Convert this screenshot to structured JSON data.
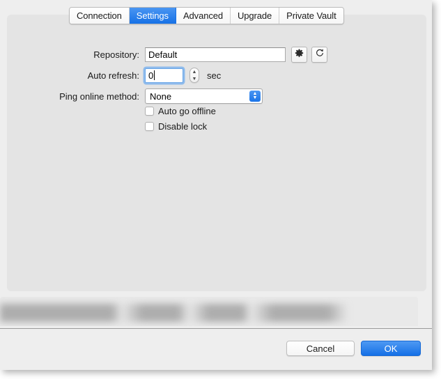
{
  "window": {
    "tabs": [
      {
        "label": "Connection",
        "selected": false
      },
      {
        "label": "Settings",
        "selected": true
      },
      {
        "label": "Advanced",
        "selected": false
      },
      {
        "label": "Upgrade",
        "selected": false
      },
      {
        "label": "Private Vault",
        "selected": false
      }
    ]
  },
  "settings": {
    "repository": {
      "label": "Repository:",
      "value": "Default",
      "placeholder": "",
      "gear_icon": "gear-icon",
      "refresh_icon": "refresh-icon"
    },
    "auto_refresh": {
      "label": "Auto refresh:",
      "value": "0",
      "unit": "sec",
      "focused": true,
      "stepper_up_icon": "chevron-up-icon",
      "stepper_down_icon": "chevron-down-icon"
    },
    "ping_online_method": {
      "label": "Ping online method:",
      "value": "None",
      "options": [
        "None"
      ],
      "arrow_icon": "chevron-up-down-icon"
    },
    "checkboxes": [
      {
        "label": "Auto go offline",
        "checked": false
      },
      {
        "label": "Disable lock",
        "checked": false
      }
    ]
  },
  "footer": {
    "cancel_label": "Cancel",
    "ok_label": "OK"
  },
  "colors": {
    "accent_blue": "#1671e6",
    "panel_bg": "#e4e4e4",
    "window_bg": "#eeeeee",
    "text": "#1a1a1a"
  }
}
